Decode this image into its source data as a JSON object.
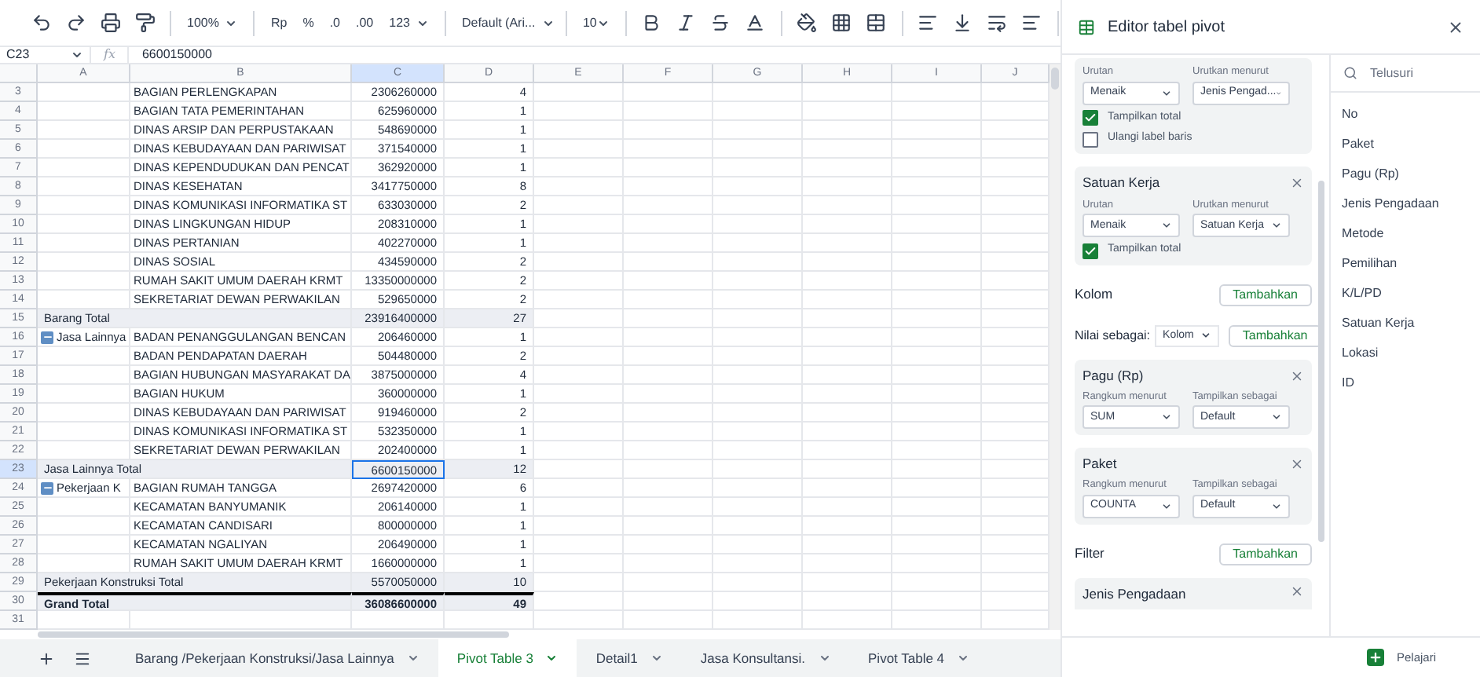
{
  "toolbar": {
    "zoom": "100%",
    "currency": "Rp",
    "percent": "%",
    "decrease_decimals": ".0",
    "increase_decimals": ".00",
    "number_format": "123",
    "font": "Default (Ari...",
    "font_size": "10"
  },
  "formula_bar": {
    "cell": "C23",
    "fx": "fx",
    "value": "6600150000"
  },
  "columns": [
    {
      "label": "A",
      "selected": false
    },
    {
      "label": "B",
      "selected": false
    },
    {
      "label": "C",
      "selected": true
    },
    {
      "label": "D",
      "selected": false
    },
    {
      "label": "E",
      "selected": false
    },
    {
      "label": "F",
      "selected": false
    },
    {
      "label": "G",
      "selected": false
    },
    {
      "label": "H",
      "selected": false
    },
    {
      "label": "I",
      "selected": false
    },
    {
      "label": "J",
      "selected": false
    }
  ],
  "rows": [
    {
      "row": "3",
      "kind": "item",
      "b": "BAGIAN PERLENGKAPAN",
      "c": "2306260000",
      "d": "4",
      "selected": false
    },
    {
      "row": "4",
      "kind": "item",
      "b": "BAGIAN TATA PEMERINTAHAN",
      "c": "625960000",
      "d": "1",
      "selected": false
    },
    {
      "row": "5",
      "kind": "item",
      "b": "DINAS ARSIP DAN PERPUSTAKAAN",
      "c": "548690000",
      "d": "1",
      "selected": false
    },
    {
      "row": "6",
      "kind": "item",
      "b": "DINAS KEBUDAYAAN DAN PARIWISAT",
      "c": "371540000",
      "d": "1",
      "selected": false
    },
    {
      "row": "7",
      "kind": "item",
      "b": "DINAS KEPENDUDUKAN DAN PENCAT",
      "c": "362920000",
      "d": "1",
      "selected": false
    },
    {
      "row": "8",
      "kind": "item",
      "b": "DINAS KESEHATAN",
      "c": "3417750000",
      "d": "8",
      "selected": false
    },
    {
      "row": "9",
      "kind": "item",
      "b": "DINAS KOMUNIKASI INFORMATIKA ST",
      "c": "633030000",
      "d": "2",
      "selected": false
    },
    {
      "row": "10",
      "kind": "item",
      "b": "DINAS LINGKUNGAN HIDUP",
      "c": "208310000",
      "d": "1",
      "selected": false
    },
    {
      "row": "11",
      "kind": "item",
      "b": "DINAS PERTANIAN",
      "c": "402270000",
      "d": "1",
      "selected": false
    },
    {
      "row": "12",
      "kind": "item",
      "b": "DINAS SOSIAL",
      "c": "434590000",
      "d": "2",
      "selected": false
    },
    {
      "row": "13",
      "kind": "item",
      "b": "RUMAH SAKIT UMUM DAERAH KRMT",
      "c": "13350000000",
      "d": "2",
      "selected": false
    },
    {
      "row": "14",
      "kind": "item",
      "b": "SEKRETARIAT DEWAN PERWAKILAN",
      "c": "529650000",
      "d": "2",
      "selected": false
    },
    {
      "row": "15",
      "kind": "total",
      "a": "Barang Total",
      "c": "23916400000",
      "d": "27",
      "selected": false
    },
    {
      "row": "16",
      "kind": "group",
      "a": "Jasa Lainnya",
      "expanded": true,
      "b": "BADAN PENANGGULANGAN BENCAN",
      "c": "206460000",
      "d": "1",
      "selected": false
    },
    {
      "row": "17",
      "kind": "item",
      "b": "BADAN PENDAPATAN DAERAH",
      "c": "504480000",
      "d": "2",
      "selected": false
    },
    {
      "row": "18",
      "kind": "item",
      "b": "BAGIAN HUBUNGAN MASYARAKAT DA",
      "c": "3875000000",
      "d": "4",
      "selected": false
    },
    {
      "row": "19",
      "kind": "item",
      "b": "BAGIAN HUKUM",
      "c": "360000000",
      "d": "1",
      "selected": false
    },
    {
      "row": "20",
      "kind": "item",
      "b": "DINAS KEBUDAYAAN DAN PARIWISAT",
      "c": "919460000",
      "d": "2",
      "selected": false
    },
    {
      "row": "21",
      "kind": "item",
      "b": "DINAS KOMUNIKASI INFORMATIKA ST",
      "c": "532350000",
      "d": "1",
      "selected": false
    },
    {
      "row": "22",
      "kind": "item",
      "b": "SEKRETARIAT DEWAN PERWAKILAN",
      "c": "202400000",
      "d": "1",
      "selected": false
    },
    {
      "row": "23",
      "kind": "total",
      "a": "Jasa Lainnya Total",
      "c": "6600150000",
      "d": "12",
      "selected": true
    },
    {
      "row": "24",
      "kind": "group",
      "a": "Pekerjaan K",
      "expanded": true,
      "b": "BAGIAN RUMAH TANGGA",
      "c": "2697420000",
      "d": "6",
      "selected": false
    },
    {
      "row": "25",
      "kind": "item",
      "b": "KECAMATAN BANYUMANIK",
      "c": "206140000",
      "d": "1",
      "selected": false
    },
    {
      "row": "26",
      "kind": "item",
      "b": "KECAMATAN CANDISARI",
      "c": "800000000",
      "d": "1",
      "selected": false
    },
    {
      "row": "27",
      "kind": "item",
      "b": "KECAMATAN NGALIYAN",
      "c": "206490000",
      "d": "1",
      "selected": false
    },
    {
      "row": "28",
      "kind": "item",
      "b": "RUMAH SAKIT UMUM DAERAH KRMT",
      "c": "1660000000",
      "d": "1",
      "selected": false
    },
    {
      "row": "29",
      "kind": "total",
      "a": "Pekerjaan Konstruksi Total",
      "c": "5570050000",
      "d": "10",
      "selected": false
    },
    {
      "row": "30",
      "kind": "grand",
      "a": "Grand Total",
      "c": "36086600000",
      "d": "49",
      "selected": false
    },
    {
      "row": "31",
      "kind": "empty",
      "selected": false
    }
  ],
  "sheet_tabs": [
    {
      "label": "Barang /Pekerjaan Konstruksi/Jasa Lainnya",
      "selected": false
    },
    {
      "label": "Pivot Table 3",
      "selected": true
    },
    {
      "label": "Detail1",
      "selected": false
    },
    {
      "label": "Jasa Konsultansi.",
      "selected": false
    },
    {
      "label": "Pivot Table 4",
      "selected": false
    }
  ],
  "pivot_editor": {
    "title": "Editor tabel pivot",
    "cards": [
      {
        "kind": "row",
        "left_label": "Urutan",
        "left_value": "Menaik",
        "right_label": "Urutkan menurut",
        "right_value": "Jenis Pengad...",
        "checkboxes": [
          {
            "label": "Tampilkan total",
            "checked": true
          },
          {
            "label": "Ulangi label baris",
            "checked": false
          }
        ]
      },
      {
        "kind": "row",
        "title": "Satuan Kerja",
        "left_label": "Urutan",
        "left_value": "Menaik",
        "right_label": "Urutkan menurut",
        "right_value": "Satuan Kerja",
        "checkboxes": [
          {
            "label": "Tampilkan total",
            "checked": true
          }
        ]
      },
      {
        "kind": "section",
        "title": "Kolom",
        "button": "Tambahkan"
      },
      {
        "kind": "values_section",
        "title": "Nilai sebagai:",
        "dropdown": "Kolom",
        "button": "Tambahkan"
      },
      {
        "kind": "value",
        "title": "Pagu (Rp)",
        "left_label": "Rangkum menurut",
        "left_value": "SUM",
        "right_label": "Tampilkan sebagai",
        "right_value": "Default"
      },
      {
        "kind": "value",
        "title": "Paket",
        "left_label": "Rangkum menurut",
        "left_value": "COUNTA",
        "right_label": "Tampilkan sebagai",
        "right_value": "Default"
      },
      {
        "kind": "section",
        "title": "Filter",
        "button": "Tambahkan"
      },
      {
        "kind": "filter",
        "title": "Jenis Pengadaan"
      }
    ],
    "search_placeholder": "Telusuri",
    "fields": [
      "No",
      "Paket",
      "Pagu (Rp)",
      "Jenis Pengadaan",
      "Metode",
      "Pemilihan",
      "K/L/PD",
      "Satuan Kerja",
      "Lokasi",
      "ID"
    ],
    "learn_button": "Pelajari"
  }
}
